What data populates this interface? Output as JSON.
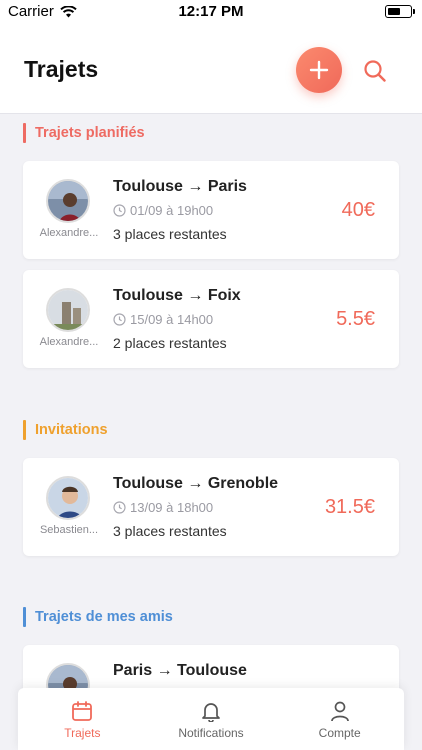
{
  "status_bar": {
    "carrier": "Carrier",
    "time": "12:17 PM"
  },
  "header": {
    "title": "Trajets",
    "add_icon": "plus-icon",
    "search_icon": "search-icon"
  },
  "colors": {
    "accent": "#f06a5a",
    "planned": "#ee6b63",
    "invitations": "#efa12e",
    "friends": "#4f8fd6"
  },
  "sections": {
    "planned": {
      "title": "Trajets planifiés",
      "trips": [
        {
          "driver": "Alexandre...",
          "route": "Toulouse → Paris",
          "date": "01/09 à 19h00",
          "places": "3 places restantes",
          "price": "40€"
        },
        {
          "driver": "Alexandre...",
          "route": "Toulouse → Foix",
          "date": "15/09 à 14h00",
          "places": "2 places restantes",
          "price": "5.5€"
        }
      ]
    },
    "invitations": {
      "title": "Invitations",
      "trips": [
        {
          "driver": "Sebastien...",
          "route": "Toulouse → Grenoble",
          "date": "13/09 à 18h00",
          "places": "3 places restantes",
          "price": "31.5€"
        }
      ]
    },
    "friends": {
      "title": "Trajets de mes amis",
      "trips": [
        {
          "route": "Paris → Toulouse"
        }
      ]
    }
  },
  "tabbar": {
    "tabs": [
      {
        "label": "Trajets",
        "icon": "calendar-icon",
        "active": true
      },
      {
        "label": "Notifications",
        "icon": "bell-icon",
        "active": false
      },
      {
        "label": "Compte",
        "icon": "user-icon",
        "active": false
      }
    ]
  }
}
